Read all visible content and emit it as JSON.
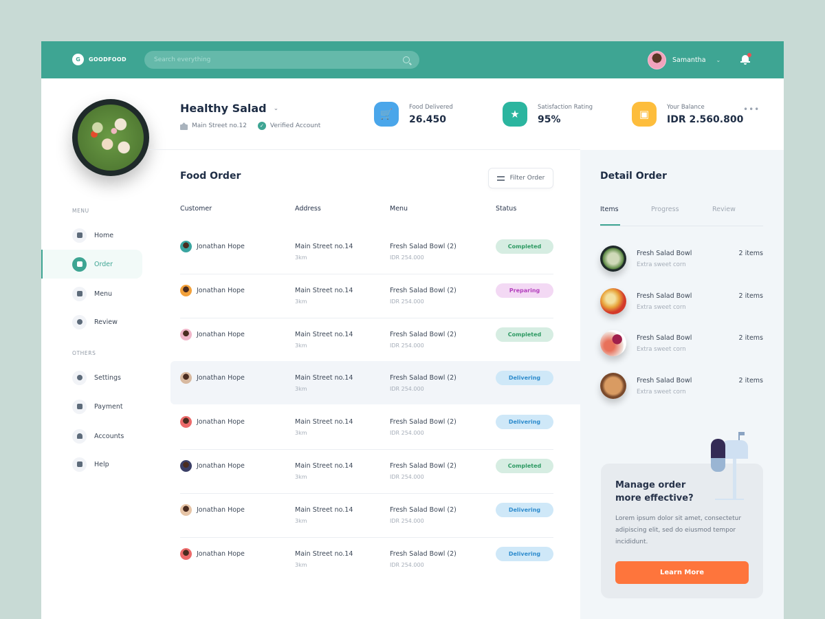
{
  "brand": {
    "logo_letter": "G",
    "name": "GOODFOOD"
  },
  "search": {
    "placeholder": "Search everything"
  },
  "user": {
    "name": "Samantha",
    "notifications": true
  },
  "profile": {
    "title": "Healthy Salad",
    "address": "Main Street no.12",
    "verified_label": "Verified Account"
  },
  "stats": [
    {
      "label": "Food Delivered",
      "value": "26.450",
      "icon": "cart-icon",
      "color": "#4aa6ea"
    },
    {
      "label": "Satisfaction Rating",
      "value": "95%",
      "icon": "star-icon",
      "color": "#2bb59f"
    },
    {
      "label": "Your Balance",
      "value": "IDR 2.560.800",
      "icon": "wallet-icon",
      "color": "#fdbd3c"
    }
  ],
  "sidebar": {
    "menu_heading": "MENU",
    "others_heading": "OTHERS",
    "items": [
      {
        "label": "Home",
        "icon": "chart-icon"
      },
      {
        "label": "Order",
        "icon": "cart-icon",
        "active": true
      },
      {
        "label": "Menu",
        "icon": "document-icon"
      },
      {
        "label": "Review",
        "icon": "chat-icon"
      },
      {
        "label": "Settings",
        "icon": "gear-icon"
      },
      {
        "label": "Payment",
        "icon": "wallet-icon"
      },
      {
        "label": "Accounts",
        "icon": "user-icon"
      },
      {
        "label": "Help",
        "icon": "info-icon"
      }
    ]
  },
  "orders": {
    "title": "Food Order",
    "filter_label": "Filter Order",
    "columns": [
      "Customer",
      "Address",
      "Menu",
      "Status"
    ],
    "rows": [
      {
        "customer": "Jonathan Hope",
        "address": "Main Street no.14",
        "distance": "3km",
        "menu": "Fresh Salad Bowl (2)",
        "price": "IDR 254.000",
        "status": "Completed"
      },
      {
        "customer": "Jonathan Hope",
        "address": "Main Street no.14",
        "distance": "3km",
        "menu": "Fresh Salad Bowl (2)",
        "price": "IDR 254.000",
        "status": "Preparing"
      },
      {
        "customer": "Jonathan Hope",
        "address": "Main Street no.14",
        "distance": "3km",
        "menu": "Fresh Salad Bowl (2)",
        "price": "IDR 254.000",
        "status": "Completed"
      },
      {
        "customer": "Jonathan Hope",
        "address": "Main Street no.14",
        "distance": "3km",
        "menu": "Fresh Salad Bowl (2)",
        "price": "IDR 254.000",
        "status": "Delivering",
        "selected": true
      },
      {
        "customer": "Jonathan Hope",
        "address": "Main Street no.14",
        "distance": "3km",
        "menu": "Fresh Salad Bowl (2)",
        "price": "IDR 254.000",
        "status": "Delivering"
      },
      {
        "customer": "Jonathan Hope",
        "address": "Main Street no.14",
        "distance": "3km",
        "menu": "Fresh Salad Bowl (2)",
        "price": "IDR 254.000",
        "status": "Completed"
      },
      {
        "customer": "Jonathan Hope",
        "address": "Main Street no.14",
        "distance": "3km",
        "menu": "Fresh Salad Bowl (2)",
        "price": "IDR 254.000",
        "status": "Delivering"
      },
      {
        "customer": "Jonathan Hope",
        "address": "Main Street no.14",
        "distance": "3km",
        "menu": "Fresh Salad Bowl (2)",
        "price": "IDR 254.000",
        "status": "Delivering"
      }
    ]
  },
  "status_colors": {
    "Completed": {
      "bg": "#d6ede2",
      "fg": "#2e9a63"
    },
    "Preparing": {
      "bg": "#f3d9f4",
      "fg": "#b33fbd"
    },
    "Delivering": {
      "bg": "#cfe8f8",
      "fg": "#2f8ccd"
    }
  },
  "detail": {
    "title": "Detail Order",
    "tabs": [
      "Items",
      "Progress",
      "Review"
    ],
    "active_tab": "Items",
    "items": [
      {
        "name": "Fresh Salad Bowl",
        "note": "Extra sweet corn",
        "qty": "2 items"
      },
      {
        "name": "Fresh Salad Bowl",
        "note": "Extra sweet corn",
        "qty": "2 items"
      },
      {
        "name": "Fresh Salad Bowl",
        "note": "Extra sweet corn",
        "qty": "2 items"
      },
      {
        "name": "Fresh Salad Bowl",
        "note": "Extra sweet corn",
        "qty": "2 items"
      }
    ]
  },
  "promo": {
    "title": "Manage order more effective?",
    "body": "Lorem ipsum dolor sit amet, consectetur adipiscing elit, sed do eiusmod tempor incididunt.",
    "button": "Learn More"
  }
}
